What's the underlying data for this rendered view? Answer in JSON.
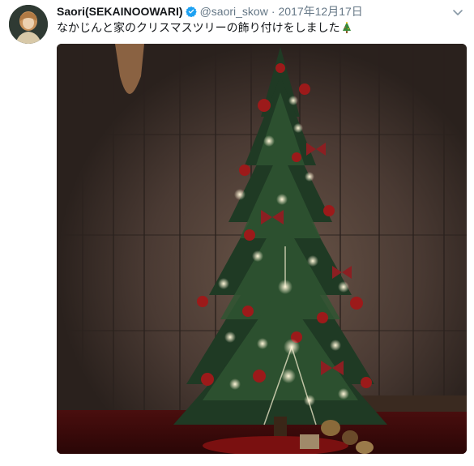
{
  "tweet": {
    "author_name": "Saori(SEKAINOOWARI)",
    "handle": "@saori_skow",
    "separator": "·",
    "date": "2017年12月17日",
    "text": "なかじんと家のクリスマスツリーの飾り付けをしました",
    "verified": true
  },
  "icons": {
    "verified": "verified-badge-icon",
    "menu": "chevron-down-icon",
    "emoji": "christmas-tree-emoji"
  },
  "colors": {
    "verified_blue": "#1da1f2",
    "secondary_text": "#657786",
    "primary_text": "#14171a"
  }
}
